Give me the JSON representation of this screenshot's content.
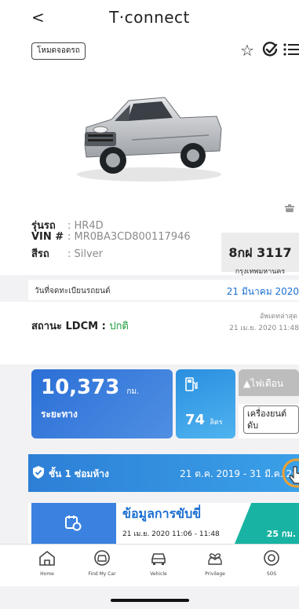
{
  "header": {
    "back_glyph": "<",
    "brand": "T·connect"
  },
  "hero": {
    "park_mode_label": "โหมดจอดรถ",
    "icons": [
      "star-icon",
      "check-circle-icon",
      "list-icon",
      "trash-icon"
    ]
  },
  "vehicle": {
    "model_label": "รุ่นรถ",
    "model_value": ": HR4D",
    "vin_label": "VIN #",
    "vin_value": ": MR0BA3CD800117946",
    "color_label": "สีรถ",
    "color_value": ": Silver",
    "plate_number": "8กฝ 3117",
    "plate_province": "กรุงเทพมหานคร"
  },
  "registration": {
    "label": "วันที่จดทะเบียนรถยนต์",
    "date": "21 มีนาคม 2020"
  },
  "ldcm": {
    "label": "สถานะ LDCM :",
    "status": "ปกติ",
    "updated_label": "อัพเดทล่าสุด",
    "updated_time": "21 เม.ย. 2020 11:48"
  },
  "tiles": {
    "distance_value": "10,373",
    "distance_unit": "กม.",
    "distance_label": "ระยะทาง",
    "fuel_value": "74",
    "fuel_unit": "ลิตร",
    "warning_label": "▲ไฟเตือน",
    "engine_label": "เครื่องยนต์ดับ"
  },
  "warranty": {
    "title": "ชั้น 1 ซ่อมห้าง",
    "date_range": "21 ต.ค. 2019 - 31 มี.ค. 2020"
  },
  "driving": {
    "title": "ข้อมูลการขับขี่",
    "time": "21 เม.ย. 2020 11:06 - 11:48",
    "distance": "25 กม."
  },
  "tabbar": {
    "items": [
      {
        "label": "Home",
        "icon": "home-icon"
      },
      {
        "label": "Find My Car",
        "icon": "find-car-icon"
      },
      {
        "label": "Vehicle",
        "icon": "vehicle-icon"
      },
      {
        "label": "Privilege",
        "icon": "privilege-icon"
      },
      {
        "label": "SOS",
        "icon": "sos-icon"
      }
    ]
  },
  "colors": {
    "accent_blue": "#1b6fd1",
    "status_green": "#1a9c3a",
    "teal": "#18b3a2"
  }
}
